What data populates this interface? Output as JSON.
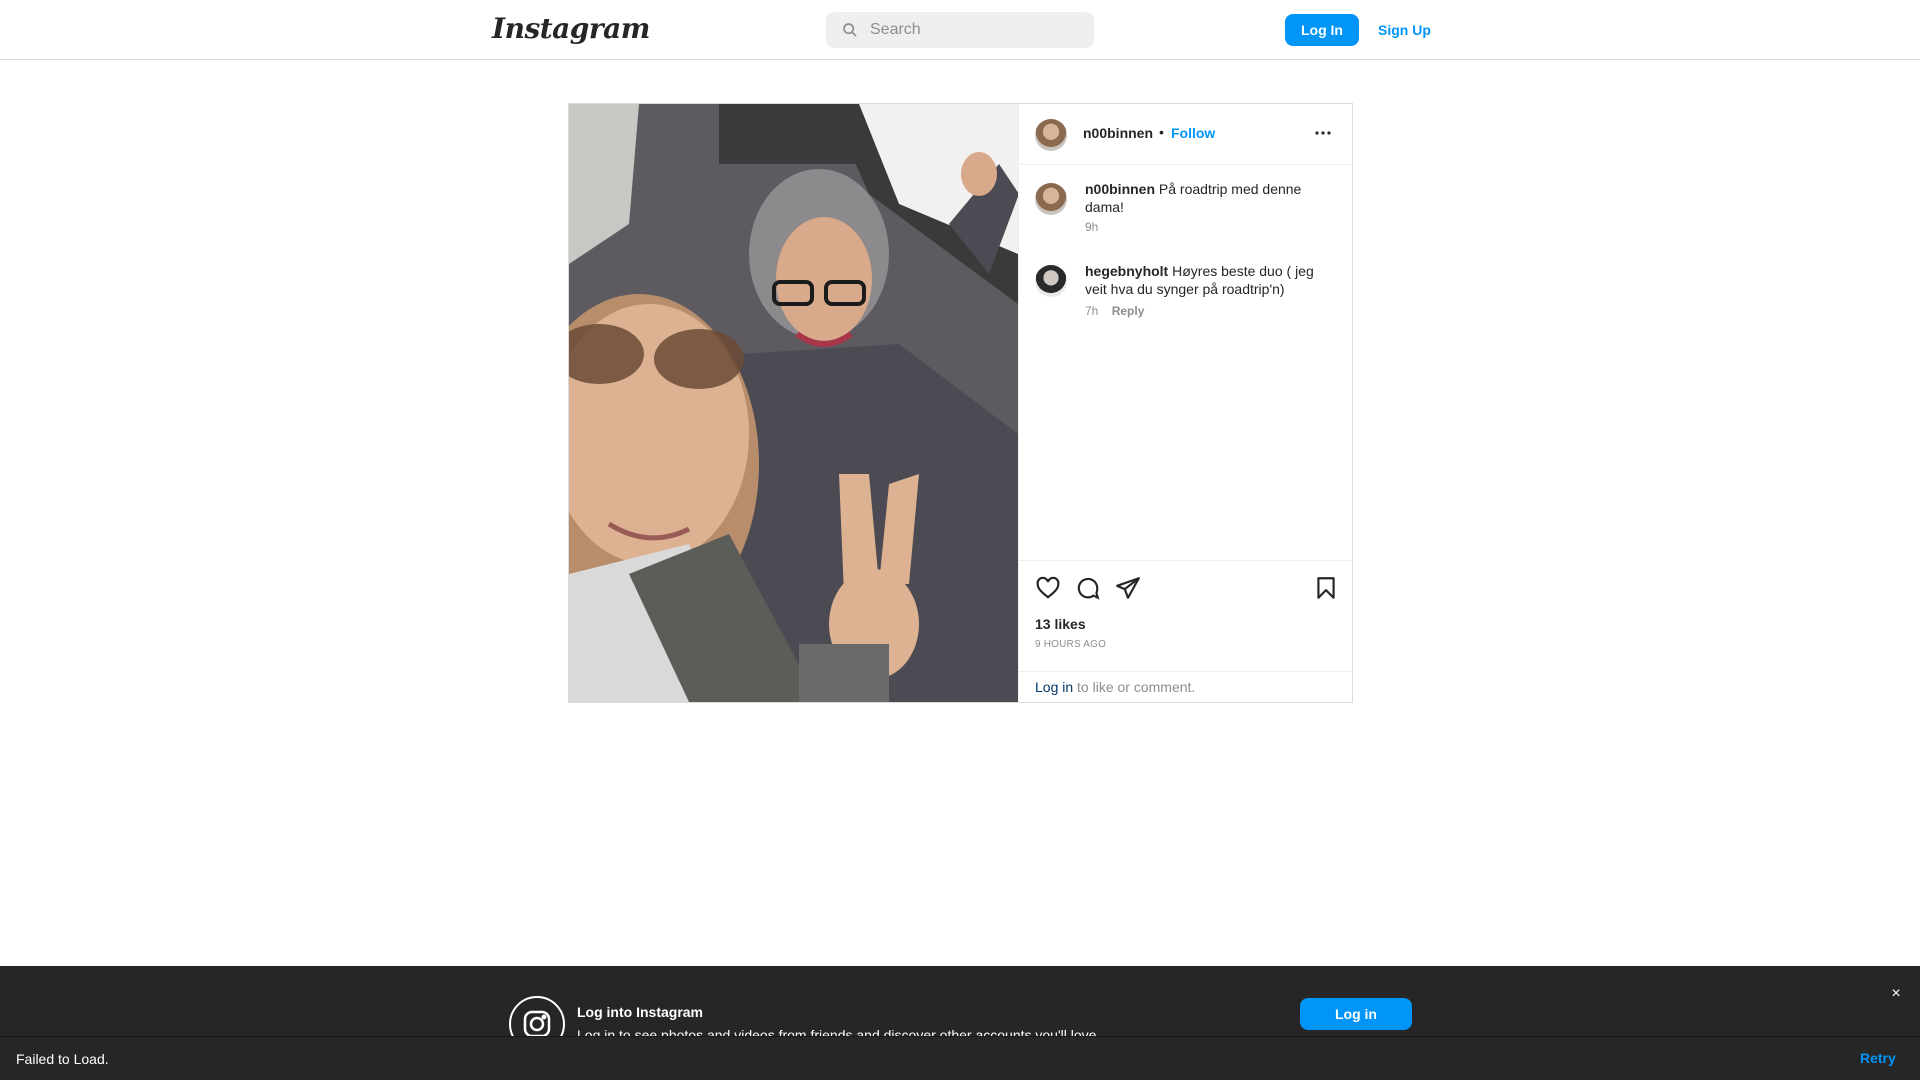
{
  "header": {
    "logo_text": "Instagram",
    "search_placeholder": "Search",
    "login_label": "Log In",
    "signup_label": "Sign Up"
  },
  "post": {
    "author": "n00binnen",
    "separator": "•",
    "follow_label": "Follow",
    "more_icon": "more-horizontal-icon",
    "comments": [
      {
        "username": "n00binnen",
        "text": "På roadtrip med denne dama!",
        "time": "9h",
        "reply_label": ""
      },
      {
        "username": "hegebnyholt",
        "text": "Høyres beste duo ( jeg veit hva du synger på roadtrip'n)",
        "time": "7h",
        "reply_label": "Reply"
      }
    ],
    "likes": "13 likes",
    "time_ago": "9 HOURS AGO",
    "login_prompt": {
      "link": "Log in",
      "rest": " to like or comment."
    }
  },
  "banner": {
    "title": "Log into Instagram",
    "subtitle": "Log in to see photos and videos from friends and discover other accounts you'll love.",
    "login_label": "Log in",
    "close_label": "×"
  },
  "toast": {
    "message": "Failed to Load.",
    "retry_label": "Retry"
  },
  "colors": {
    "accent": "#0095f6",
    "banner_bg": "#262626"
  }
}
